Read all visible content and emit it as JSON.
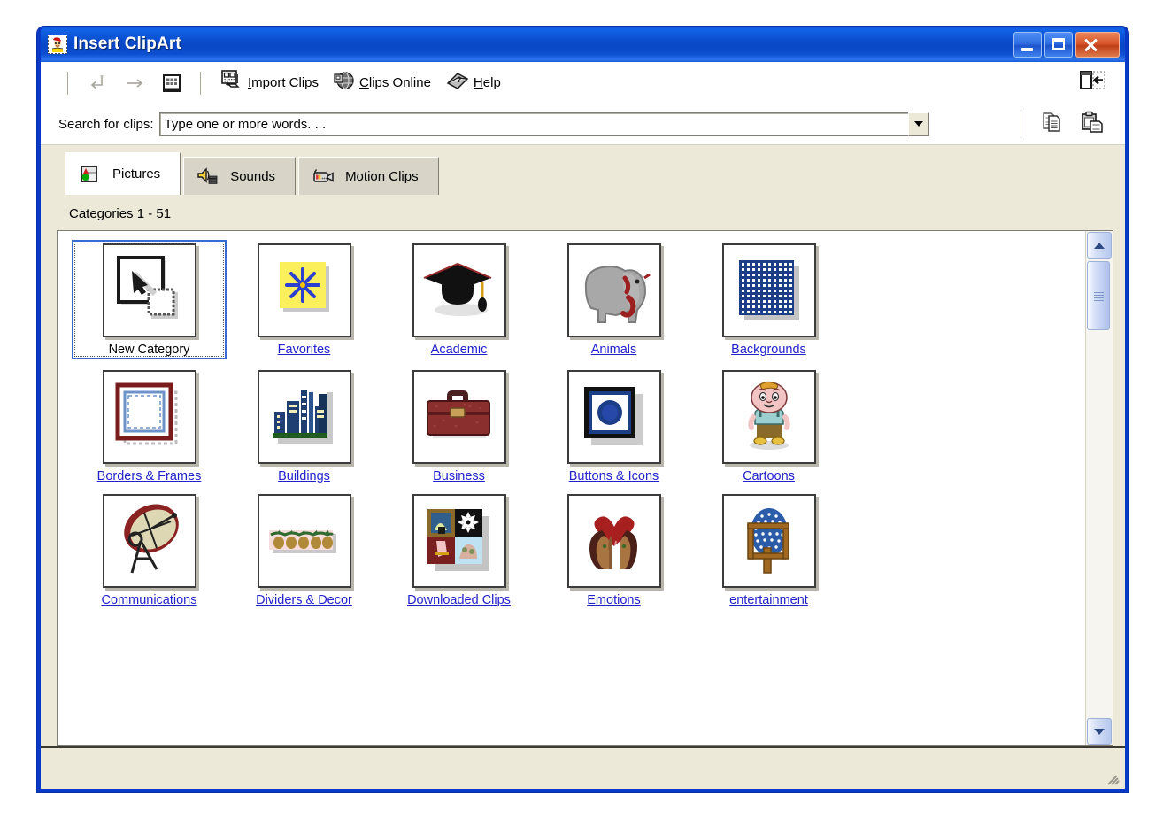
{
  "window": {
    "title": "Insert ClipArt",
    "icon": "clipart-jester-icon",
    "buttons": {
      "minimize": "Minimize",
      "maximize": "Maximize",
      "close": "Close"
    }
  },
  "toolbar": {
    "back_label": "Back",
    "forward_label": "Forward",
    "all_categories_label": "All Categories",
    "import_clips_label": "Import Clips",
    "import_clips_accel": "I",
    "clips_online_label": "Clips Online",
    "clips_online_accel": "C",
    "help_label": "Help",
    "help_accel": "H",
    "change_window_label": "Change to Small Window"
  },
  "search": {
    "label": "Search for clips:",
    "value": "Type one or more words. . .",
    "placeholder": "Type one or more words. . .",
    "copy_label": "Copy",
    "paste_label": "Paste"
  },
  "tabs": [
    {
      "label": "Pictures",
      "icon": "pictures-icon",
      "active": true
    },
    {
      "label": "Sounds",
      "icon": "sounds-icon",
      "active": false
    },
    {
      "label": "Motion Clips",
      "icon": "motion-clips-icon",
      "active": false
    }
  ],
  "content": {
    "category_count_text": "Categories 1 - 51",
    "total_categories": 51,
    "range_start": 1,
    "range_end": 51
  },
  "categories": [
    {
      "label": "New Category",
      "icon": "new-category-icon",
      "selected": true
    },
    {
      "label": "Favorites",
      "icon": "favorites-icon",
      "selected": false
    },
    {
      "label": "Academic",
      "icon": "academic-icon",
      "selected": false
    },
    {
      "label": "Animals",
      "icon": "animals-icon",
      "selected": false
    },
    {
      "label": "Backgrounds",
      "icon": "backgrounds-icon",
      "selected": false
    },
    {
      "label": "Borders & Frames",
      "icon": "borders-frames-icon",
      "selected": false
    },
    {
      "label": "Buildings",
      "icon": "buildings-icon",
      "selected": false
    },
    {
      "label": "Business",
      "icon": "business-icon",
      "selected": false
    },
    {
      "label": "Buttons & Icons",
      "icon": "buttons-icons-icon",
      "selected": false
    },
    {
      "label": "Cartoons",
      "icon": "cartoons-icon",
      "selected": false
    },
    {
      "label": "Communications",
      "icon": "communications-icon",
      "selected": false
    },
    {
      "label": "Dividers & Decor",
      "icon": "dividers-decor-icon",
      "selected": false
    },
    {
      "label": "Downloaded Clips",
      "icon": "downloaded-clips-icon",
      "selected": false
    },
    {
      "label": "Emotions",
      "icon": "emotions-icon",
      "selected": false
    },
    {
      "label": "entertainment",
      "icon": "entertainment-icon",
      "selected": false
    }
  ],
  "scrollbar": {
    "up_label": "Scroll up",
    "down_label": "Scroll down",
    "thumb_label": "Scroll thumb"
  },
  "statusbar": {
    "text": ""
  },
  "colors": {
    "title_blue": "#0a39c8",
    "client_beige": "#ece9d8",
    "link_blue": "#2222cc",
    "selection_blue": "#3a6bd0",
    "close_red": "#d9552a"
  }
}
